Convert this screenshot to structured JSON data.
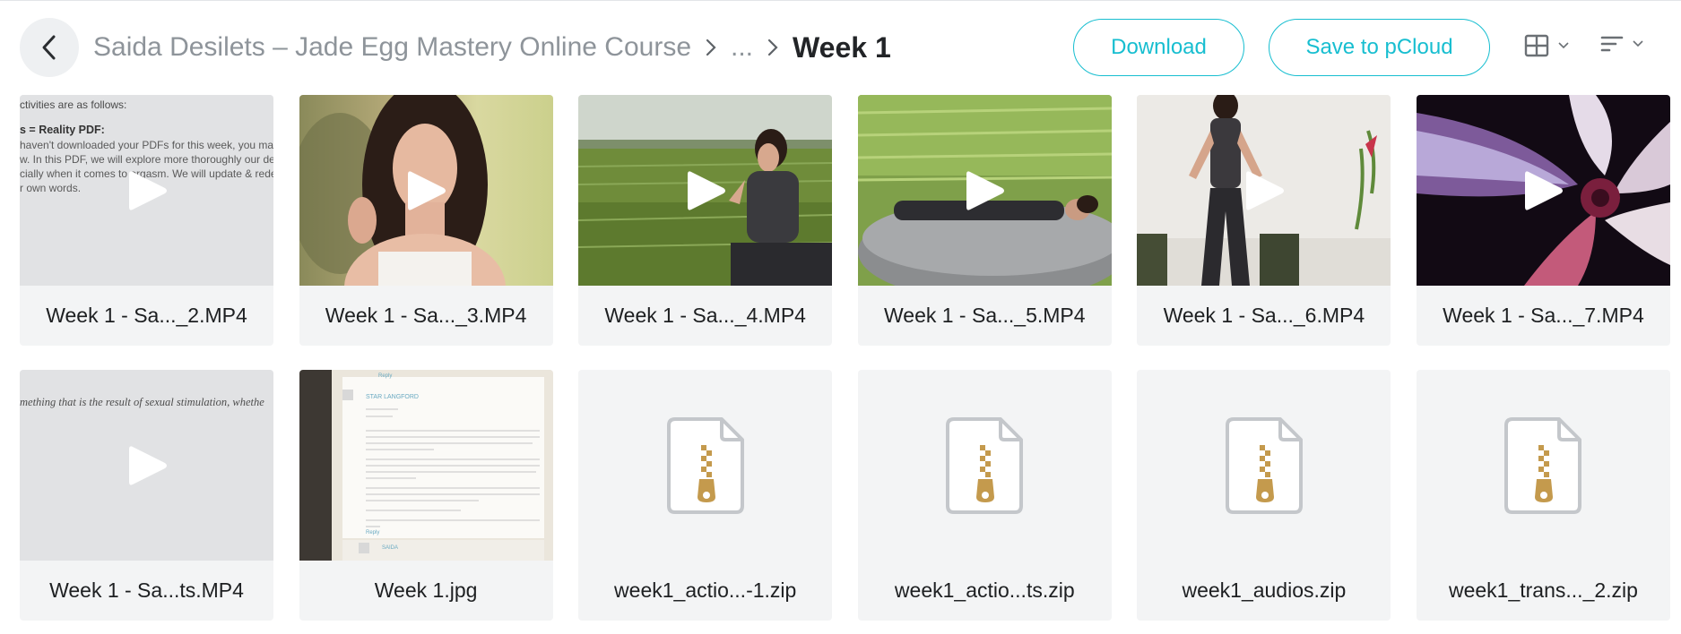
{
  "header": {
    "breadcrumb": {
      "root": "Saida Desilets – Jade Egg Mastery Online Course",
      "ellipsis": "...",
      "current": "Week 1"
    },
    "download_label": "Download",
    "save_label": "Save to pCloud",
    "view_icon": "grid-view-icon",
    "sort_icon": "sort-icon"
  },
  "colors": {
    "accent": "#17bed0",
    "card_bg": "#f3f4f5",
    "zip_stroke": "#c4c7cb",
    "zipper": "#c49a4d"
  },
  "files": [
    {
      "name": "Week 1 - Sa..._2.MP4",
      "type": "video",
      "thumb_text": [
        "ctivities are as follows:",
        "s = Reality PDF:",
        "haven't downloaded your PDFs for this week, you ma",
        "w. In this PDF, we will explore more thoroughly our de",
        "cially when it comes to orgasm. We will update & rede",
        "r own words."
      ]
    },
    {
      "name": "Week 1 - Sa..._3.MP4",
      "type": "video"
    },
    {
      "name": "Week 1 - Sa..._4.MP4",
      "type": "video"
    },
    {
      "name": "Week 1 - Sa..._5.MP4",
      "type": "video"
    },
    {
      "name": "Week 1 - Sa..._6.MP4",
      "type": "video"
    },
    {
      "name": "Week 1 - Sa..._7.MP4",
      "type": "video"
    },
    {
      "name": "Week 1 - Sa...ts.MP4",
      "type": "video",
      "thumb_text": [
        "mething that is the result of sexual stimulation, whethe"
      ]
    },
    {
      "name": "Week 1.jpg",
      "type": "image",
      "thumb_text": [
        "Reply",
        "STAR LANGFORD",
        "Reply",
        "SAIDA"
      ]
    },
    {
      "name": "week1_actio...-1.zip",
      "type": "zip"
    },
    {
      "name": "week1_actio...ts.zip",
      "type": "zip"
    },
    {
      "name": "week1_audios.zip",
      "type": "zip"
    },
    {
      "name": "week1_trans..._2.zip",
      "type": "zip"
    }
  ]
}
